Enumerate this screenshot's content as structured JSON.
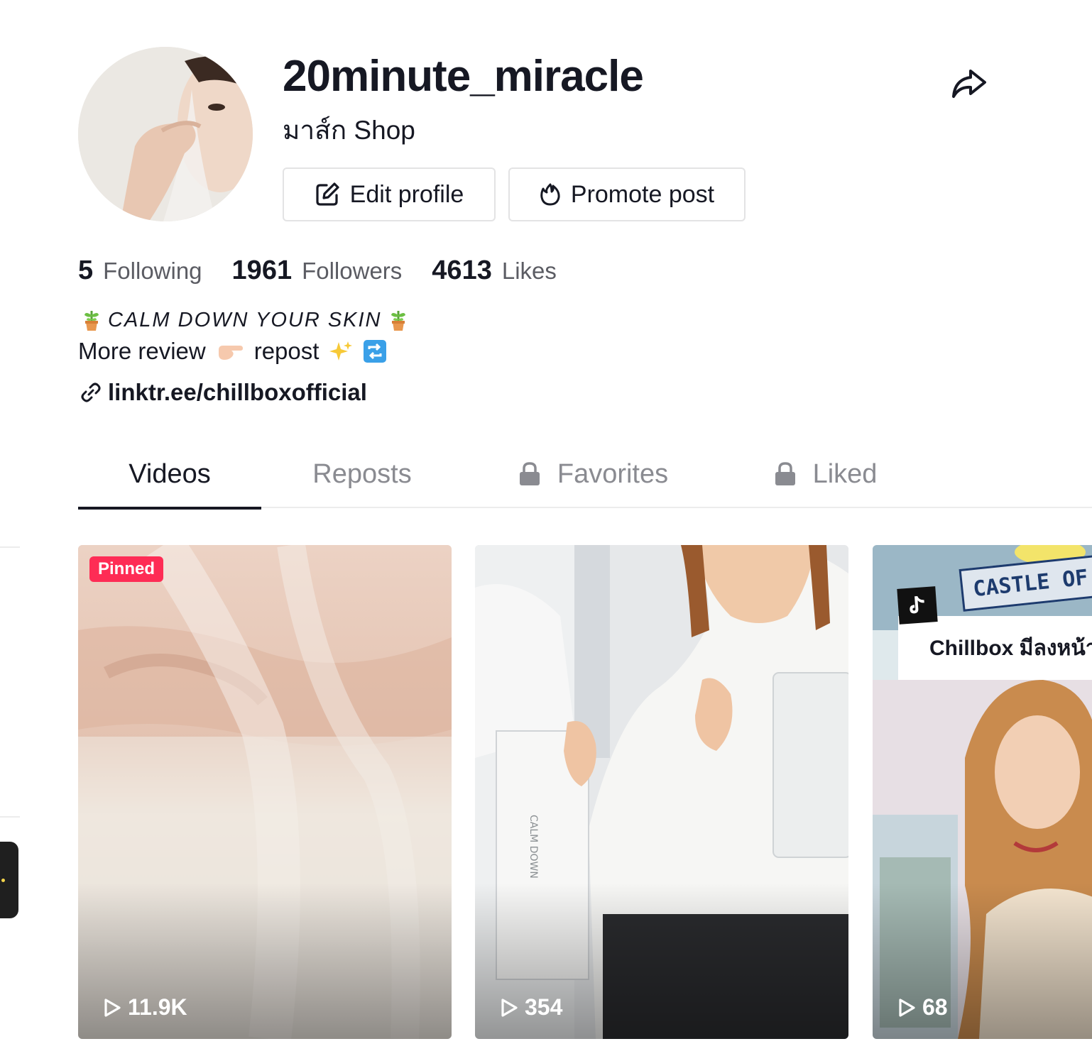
{
  "profile": {
    "username": "20minute_miracle",
    "nickname": "มาส์ก Shop"
  },
  "actions": {
    "edit_profile": "Edit profile",
    "promote_post": "Promote post"
  },
  "stats": [
    {
      "count": "5",
      "label": "Following"
    },
    {
      "count": "1961",
      "label": "Followers"
    },
    {
      "count": "4613",
      "label": "Likes"
    }
  ],
  "bio": {
    "line1": "CALM DOWN YOUR SKIN",
    "line2_part1": "More review",
    "line2_part2": "repost",
    "link": "linktr.ee/chillboxofficial"
  },
  "tabs": [
    {
      "label": "Videos",
      "active": true,
      "locked": false
    },
    {
      "label": "Reposts",
      "active": false,
      "locked": false
    },
    {
      "label": "Favorites",
      "active": false,
      "locked": true
    },
    {
      "label": "Liked",
      "active": false,
      "locked": true
    }
  ],
  "videos": [
    {
      "views": "11.9K",
      "badge": "Pinned"
    },
    {
      "views": "354"
    },
    {
      "views": "68",
      "caption": "Chillbox มีลงหน้า",
      "sign_text": "CASTLE OF THE"
    }
  ],
  "colors": {
    "accent": "#fe2c55",
    "text_primary": "#161823",
    "text_secondary": "#5b5c63",
    "border": "#e3e3e4"
  },
  "icons": {
    "share": "share-arrow-icon",
    "edit": "edit-pencil-icon",
    "promote": "flame-icon",
    "link": "link-chain-icon",
    "lock": "lock-icon",
    "play": "play-outline-icon"
  }
}
